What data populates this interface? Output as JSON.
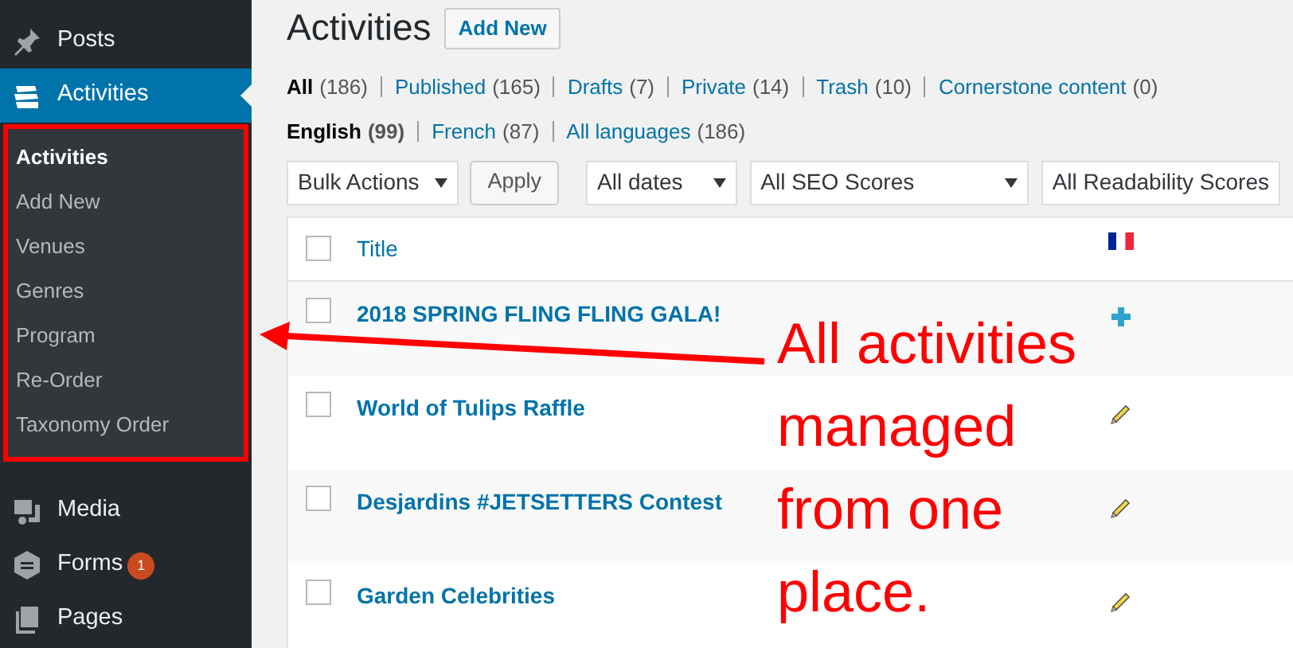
{
  "sidebar": {
    "items": [
      {
        "label": "Posts",
        "selected": false
      },
      {
        "label": "Activities",
        "selected": true,
        "submenu": [
          {
            "label": "Activities",
            "selected": true
          },
          {
            "label": "Add New",
            "selected": false
          },
          {
            "label": "Venues",
            "selected": false
          },
          {
            "label": "Genres",
            "selected": false
          },
          {
            "label": "Program",
            "selected": false
          },
          {
            "label": "Re-Order",
            "selected": false
          },
          {
            "label": "Taxonomy Order",
            "selected": false
          }
        ]
      },
      {
        "label": "Media",
        "selected": false
      },
      {
        "label": "Forms",
        "selected": false,
        "badge": "1"
      },
      {
        "label": "Pages",
        "selected": false
      }
    ]
  },
  "page": {
    "title": "Activities",
    "add_new": "Add New"
  },
  "status_filters": [
    {
      "label": "All",
      "count": "(186)",
      "selected": true
    },
    {
      "label": "Published",
      "count": "(165)",
      "selected": false
    },
    {
      "label": "Drafts",
      "count": "(7)",
      "selected": false
    },
    {
      "label": "Private",
      "count": "(14)",
      "selected": false
    },
    {
      "label": "Trash",
      "count": "(10)",
      "selected": false
    },
    {
      "label": "Cornerstone content",
      "count": "(0)",
      "selected": false
    }
  ],
  "language_filters": [
    {
      "label": "English",
      "count": "(99)",
      "selected": true
    },
    {
      "label": "French",
      "count": "(87)",
      "selected": false
    },
    {
      "label": "All languages",
      "count": "(186)",
      "selected": false
    }
  ],
  "toolbar": [
    {
      "kind": "select",
      "label": "Bulk Actions"
    },
    {
      "kind": "button",
      "label": "Apply"
    },
    {
      "kind": "select",
      "label": "All dates"
    },
    {
      "kind": "select",
      "label": "All SEO Scores"
    },
    {
      "kind": "select",
      "label": "All Readability Scores"
    }
  ],
  "table": {
    "columns": [
      "Title"
    ],
    "select_all_checked": false,
    "rows": [
      {
        "title": "2018 SPRING FLING FLING GALA!",
        "kind": "add",
        "checked": false
      },
      {
        "title": "World of Tulips Raffle",
        "kind": "edit",
        "checked": false
      },
      {
        "title": "Desjardins #JETSETTERS Contest",
        "kind": "edit",
        "checked": false
      },
      {
        "title": "Garden Celebrities",
        "kind": "edit",
        "checked": false
      }
    ]
  },
  "annotation": {
    "text": "All activities managed from one place."
  }
}
